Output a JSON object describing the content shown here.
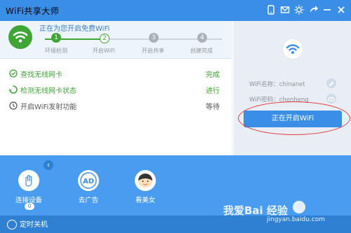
{
  "app": {
    "title": "WiFi共享大师"
  },
  "titlebar_icons": [
    "phone-icon",
    "mail-icon",
    "settings-icon",
    "share-icon",
    "minimize-icon",
    "close-icon"
  ],
  "top": {
    "status": "正在为您开启免费WiFi",
    "steps": [
      {
        "num": "1",
        "label": "环境检测",
        "state": "done"
      },
      {
        "num": "2",
        "label": "开启WiFi",
        "state": "active"
      },
      {
        "num": "3",
        "label": "开启共享",
        "state": "pending"
      },
      {
        "num": "4",
        "label": "创建完成",
        "state": "pending"
      }
    ]
  },
  "checks": [
    {
      "label": "查找无线网卡",
      "status": "完成",
      "state": "done"
    },
    {
      "label": "检测无线网卡状态",
      "status": "进行",
      "state": "running"
    },
    {
      "label": "开启WiFi发射功能",
      "status": "等待",
      "state": "waiting"
    }
  ],
  "wifi": {
    "name_label": "WiFi名称：chinanet",
    "password_label": "WiFi密码：chenheng",
    "button": "正在开启WiFi"
  },
  "tools": [
    {
      "label": "连接设备",
      "badge": "0"
    },
    {
      "label": "去广告",
      "glyph": "AD"
    },
    {
      "label": "看美女"
    }
  ],
  "footer": {
    "timer_label": "定时关机"
  },
  "watermark": {
    "text": "我爱Bai 经验",
    "sub": "jingyan.baidu.com"
  },
  "colors": {
    "primary": "#3a8ee6",
    "green": "#3fa535",
    "red_outline": "#e33b3b"
  }
}
